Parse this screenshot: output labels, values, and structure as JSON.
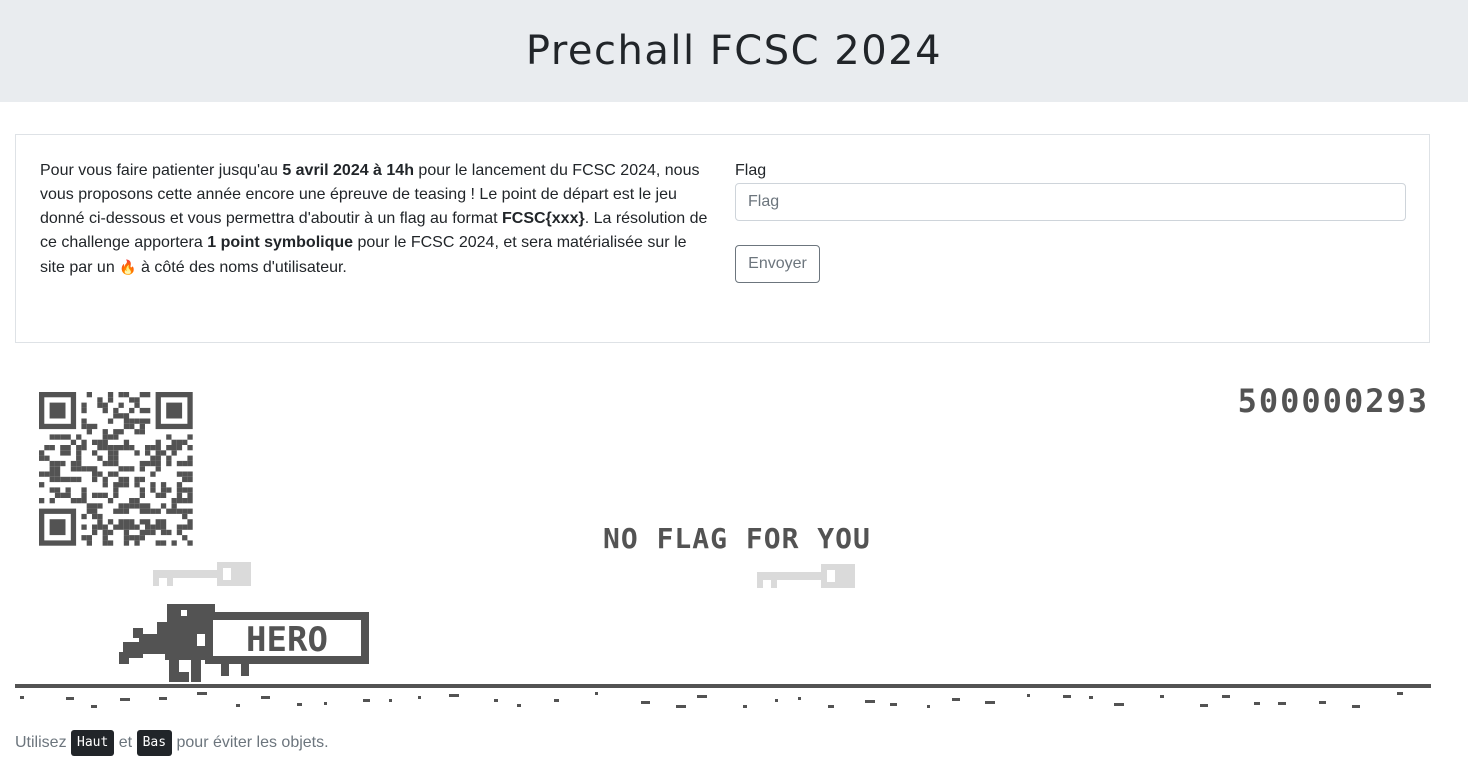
{
  "header": {
    "title": "Prechall FCSC 2024"
  },
  "intro": {
    "p1": "Pour vous faire patienter jusqu'au ",
    "b1": "5 avril 2024 à 14h",
    "p2": " pour le lancement du FCSC 2024, nous vous proposons cette année encore une épreuve de teasing ! Le point de départ est le jeu donné ci-dessous et vous permettra d'aboutir à un flag au format ",
    "b2": "FCSC{xxx}",
    "p3": ". La résolution de ce challenge apportera ",
    "b3": "1 point symbolique",
    "p4": " pour le FCSC 2024, et sera matérialisée sur le site par un ",
    "flame": "🔥",
    "p5": " à côté des noms d'utilisateur."
  },
  "form": {
    "label": "Flag",
    "placeholder": "Flag",
    "submit_label": "Envoyer"
  },
  "game": {
    "score": "500000293",
    "message": "NO FLAG FOR YOU",
    "sign_text": "HERO",
    "colors": {
      "ink": "#535353",
      "faded": "#dadada"
    }
  },
  "hint": {
    "before": "Utilisez ",
    "key_up": "Haut",
    "middle": " et ",
    "key_down": "Bas",
    "after": " pour éviter les objets."
  }
}
